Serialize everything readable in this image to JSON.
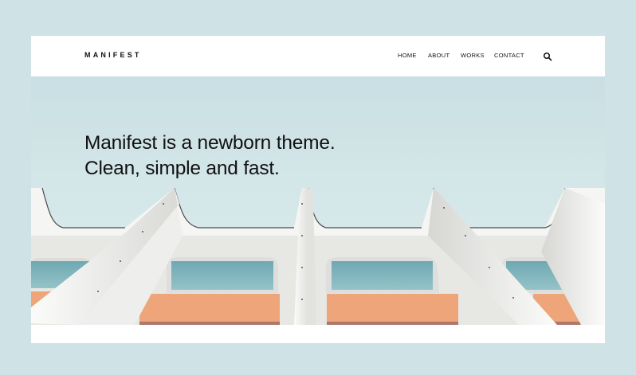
{
  "site": {
    "logo": "MANIFEST"
  },
  "nav": {
    "items": [
      {
        "label": "HOME"
      },
      {
        "label": "ABOUT"
      },
      {
        "label": "WORKS"
      },
      {
        "label": "CONTACT"
      }
    ],
    "search_icon": "search-icon"
  },
  "hero": {
    "headline_line1": "Manifest is a newborn theme.",
    "headline_line2": "Clean, simple and fast.",
    "image": "white building facade with windows and orange panels"
  },
  "colors": {
    "page_background": "#cfe3e6",
    "frame_background": "#ffffff",
    "text": "#111111",
    "sky": "#cfe3e6",
    "facade": "#f2f2f0",
    "window_glass": "#7fb3bb",
    "orange_panel": "#eda579"
  }
}
